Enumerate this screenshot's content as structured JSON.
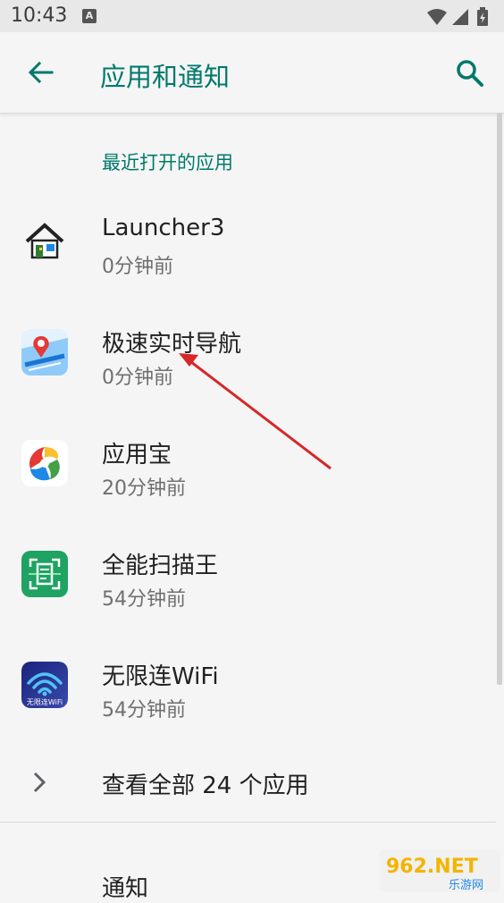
{
  "status_bar": {
    "time": "10:43",
    "notif_glyph": "A"
  },
  "app_bar": {
    "title": "应用和通知"
  },
  "recent": {
    "header": "最近打开的应用",
    "apps": [
      {
        "name": "Launcher3",
        "time": "0分钟前",
        "icon": "house-icon"
      },
      {
        "name": "极速实时导航",
        "time": "0分钟前",
        "icon": "navigation-map-icon"
      },
      {
        "name": "应用宝",
        "time": "20分钟前",
        "icon": "yingyongbao-icon"
      },
      {
        "name": "全能扫描王",
        "time": "54分钟前",
        "icon": "scanner-icon"
      },
      {
        "name": "无限连WiFi",
        "time": "54分钟前",
        "icon": "wifi-icon",
        "icon_text": "无限连WiFi"
      }
    ]
  },
  "see_all": {
    "label": "查看全部 24 个应用"
  },
  "notifications": {
    "label": "通知"
  },
  "watermark": {
    "main": "962.NET",
    "sub": "乐游网"
  },
  "colors": {
    "accent": "#00796b",
    "arrow": "#d62828"
  }
}
